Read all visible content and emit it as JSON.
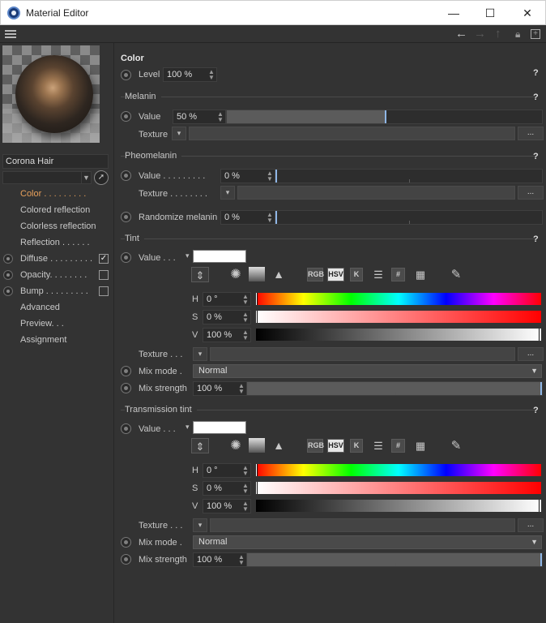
{
  "window": {
    "title": "Material Editor",
    "controls": {
      "minimize": "—",
      "maximize": "☐",
      "close": "✕"
    }
  },
  "toolbar": {
    "icons": [
      "hamburger-icon",
      "back-arrow-icon",
      "forward-arrow-icon",
      "up-arrow-icon",
      "lock-icon",
      "new-panel-icon"
    ]
  },
  "material": {
    "name": "Corona Hair"
  },
  "nav": [
    {
      "label": "Color . . . . . . . . .",
      "active": true,
      "radio": false,
      "check": null
    },
    {
      "label": "Colored reflection",
      "active": false,
      "radio": false,
      "check": null
    },
    {
      "label": "Colorless reflection",
      "active": false,
      "radio": false,
      "check": null
    },
    {
      "label": "Reflection . . . . . .",
      "active": false,
      "radio": false,
      "check": null
    },
    {
      "label": "Diffuse . . . . . . . . .",
      "active": false,
      "radio": true,
      "check": "✓"
    },
    {
      "label": "Opacity. . . . . . . .",
      "active": false,
      "radio": true,
      "check": ""
    },
    {
      "label": "Bump . . . . . . . . .",
      "active": false,
      "radio": true,
      "check": ""
    },
    {
      "label": "Advanced",
      "active": false,
      "radio": false,
      "check": null
    },
    {
      "label": "Preview. . .",
      "active": false,
      "radio": false,
      "check": null
    },
    {
      "label": "Assignment",
      "active": false,
      "radio": false,
      "check": null
    }
  ],
  "panel": {
    "header": "Color",
    "help": "?",
    "level": {
      "label": "Level",
      "value": "100 %"
    },
    "melanin": {
      "title": "Melanin",
      "value_label": "Value",
      "value": "50 %",
      "value_fraction": 0.5,
      "texture_label": "Texture"
    },
    "pheomelanin": {
      "title": "Pheomelanin",
      "value_label": "Value . . . . . . . . .",
      "value": "0 %",
      "value_fraction": 0,
      "texture_label": "Texture . . . . . . . .",
      "randomize_label": "Randomize melanin",
      "randomize_value": "0 %",
      "randomize_fraction": 0
    },
    "tint": {
      "title": "Tint",
      "value_label": "Value . . .",
      "color": "#ffffff",
      "modes": [
        "RGB",
        "HSV",
        "K"
      ],
      "selected_mode": "HSV",
      "h_label": "H",
      "h_value": "0 °",
      "s_label": "S",
      "s_value": "0 %",
      "v_label": "V",
      "v_value": "100 %",
      "texture_label": "Texture . . .",
      "mix_mode_label": "Mix mode .",
      "mix_mode_value": "Normal",
      "mix_strength_label": "Mix strength",
      "mix_strength_value": "100 %",
      "mix_strength_fraction": 1
    },
    "transmission_tint": {
      "title": "Transmission tint",
      "value_label": "Value . . .",
      "color": "#ffffff",
      "modes": [
        "RGB",
        "HSV",
        "K"
      ],
      "selected_mode": "HSV",
      "h_label": "H",
      "h_value": "0 °",
      "s_label": "S",
      "s_value": "0 %",
      "v_label": "V",
      "v_value": "100 %",
      "texture_label": "Texture . . .",
      "mix_mode_label": "Mix mode .",
      "mix_mode_value": "Normal",
      "mix_strength_label": "Mix strength",
      "mix_strength_value": "100 %",
      "mix_strength_fraction": 1
    },
    "dots_label": "...",
    "hash_label": "#"
  }
}
